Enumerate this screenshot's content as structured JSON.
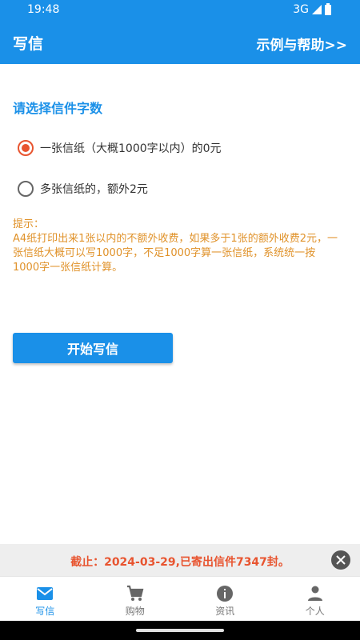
{
  "status_bar": {
    "time": "19:48",
    "network": "3G"
  },
  "app_bar": {
    "title": "写信",
    "help_link": "示例与帮助>>"
  },
  "section": {
    "title": "请选择信件字数"
  },
  "options": [
    {
      "label": "一张信纸（大概1000字以内）的0元",
      "selected": true
    },
    {
      "label": "多张信纸的，额外2元",
      "selected": false
    }
  ],
  "tip": {
    "heading": "提示：",
    "body": "A4纸打印出来1张以内的不额外收费，如果多于1张的额外收费2元，一张信纸大概可以写1000字，不足1000字算一张信纸，系统统一按1000字一张信纸计算。"
  },
  "start_button": {
    "label": "开始写信"
  },
  "notice": {
    "text": "截止：2024-03-29,已寄出信件7347封。"
  },
  "bottom_nav": {
    "items": [
      {
        "label": "写信",
        "icon": "mail-icon",
        "active": true
      },
      {
        "label": "购物",
        "icon": "cart-icon",
        "active": false
      },
      {
        "label": "资讯",
        "icon": "info-icon",
        "active": false
      },
      {
        "label": "个人",
        "icon": "person-icon",
        "active": false
      }
    ]
  },
  "colors": {
    "primary": "#1a90e8",
    "accent": "#e8542f",
    "tip": "#e0922a"
  }
}
